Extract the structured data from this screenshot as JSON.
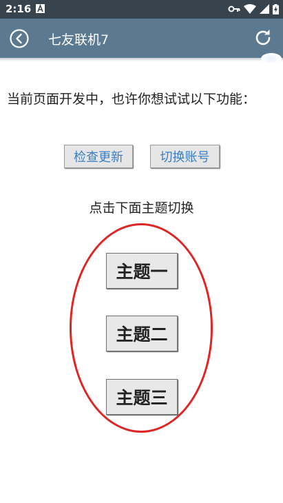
{
  "status_bar": {
    "time": "2:16"
  },
  "app_bar": {
    "title": "七友联机7"
  },
  "content": {
    "message": "当前页面开发中，也许你想试试以下功能：",
    "check_update_label": "检查更新",
    "switch_account_label": "切换账号",
    "theme_hint": "点击下面主题切换",
    "themes": [
      "主题一",
      "主题二",
      "主题三"
    ]
  },
  "colors": {
    "status_bar": "#37434d",
    "app_bar": "#5b7a91",
    "link_text": "#3a7fc4",
    "highlight_circle": "#e02525"
  }
}
